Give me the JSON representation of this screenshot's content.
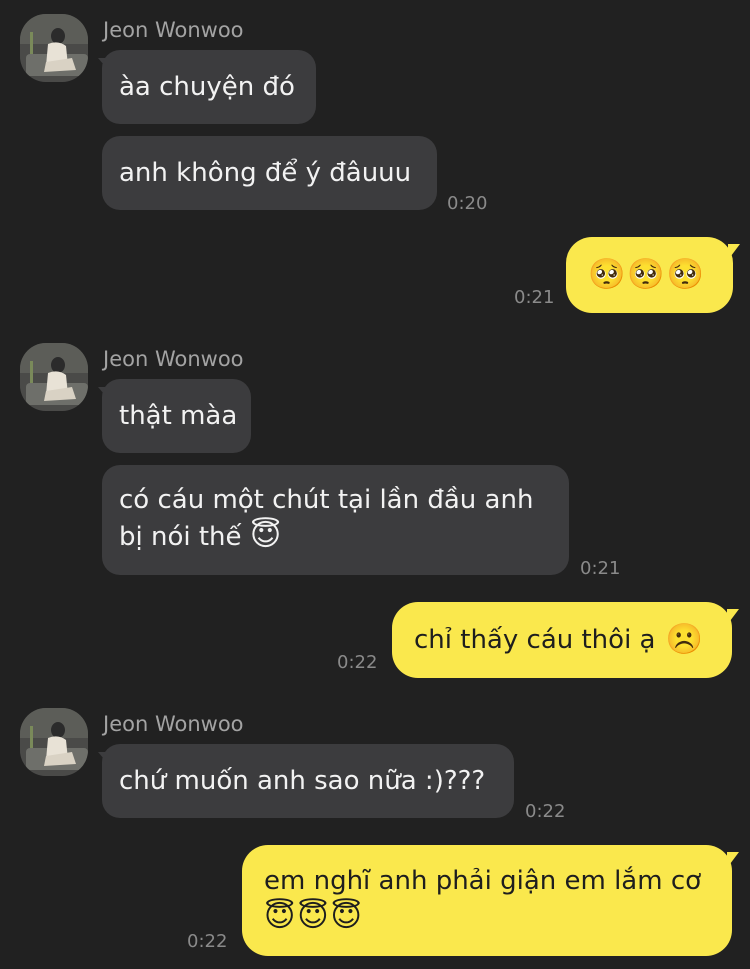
{
  "contact": {
    "name": "Jeon Wonwoo"
  },
  "messages": [
    {
      "id": "m1",
      "side": "in",
      "text": "àa chuyện đó"
    },
    {
      "id": "m2",
      "side": "in",
      "text": "anh không để ý đâuuu",
      "time": "0:20"
    },
    {
      "id": "m3",
      "side": "out",
      "text": "🥺🥺🥺",
      "time": "0:21"
    },
    {
      "id": "m4",
      "side": "in",
      "text": "thật màa"
    },
    {
      "id": "m5",
      "side": "in",
      "line1": "có cáu một chút tại lần đầu anh",
      "line2": "bị nói thế",
      "emoji": "😇",
      "time": "0:21"
    },
    {
      "id": "m6",
      "side": "out",
      "text": "chỉ thấy cáu thôi ạ",
      "emoji": "☹️",
      "time": "0:22"
    },
    {
      "id": "m7",
      "side": "in",
      "text": "chứ muốn anh sao nữa :)???",
      "time": "0:22"
    },
    {
      "id": "m8",
      "side": "out",
      "line1": "em nghĩ anh phải giận em lắm cơ",
      "emoji_line": "😇😇😇",
      "time": "0:22"
    }
  ],
  "colors": {
    "background": "#212121",
    "incoming_bubble": "#3c3c3e",
    "outgoing_bubble": "#fae84d",
    "timestamp": "#8a8a8a",
    "sender_name": "#a3a3a3"
  },
  "icons": {
    "avatar": "profile-photo"
  }
}
